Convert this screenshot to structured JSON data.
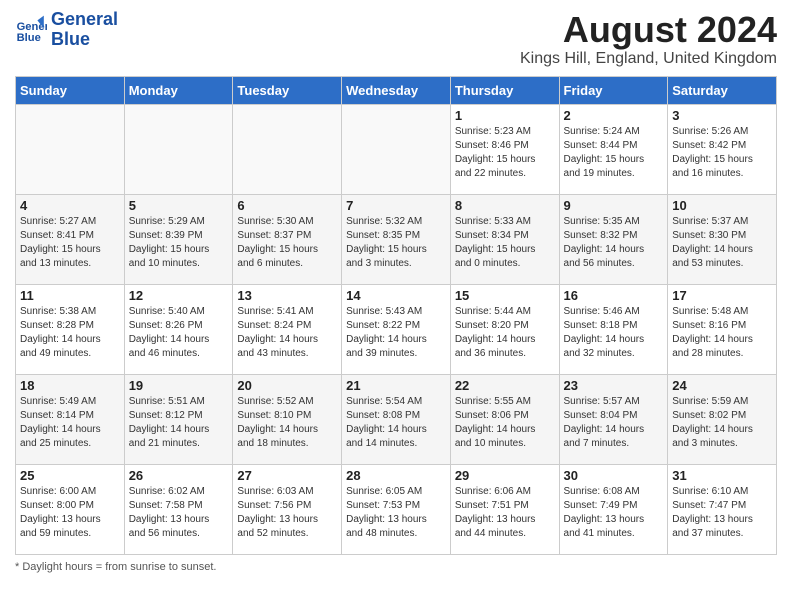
{
  "header": {
    "logo_line1": "General",
    "logo_line2": "Blue",
    "month_title": "August 2024",
    "location": "Kings Hill, England, United Kingdom"
  },
  "days_of_week": [
    "Sunday",
    "Monday",
    "Tuesday",
    "Wednesday",
    "Thursday",
    "Friday",
    "Saturday"
  ],
  "footer": {
    "note": "Daylight hours"
  },
  "weeks": [
    [
      {
        "num": "",
        "sunrise": "",
        "sunset": "",
        "daylight": ""
      },
      {
        "num": "",
        "sunrise": "",
        "sunset": "",
        "daylight": ""
      },
      {
        "num": "",
        "sunrise": "",
        "sunset": "",
        "daylight": ""
      },
      {
        "num": "",
        "sunrise": "",
        "sunset": "",
        "daylight": ""
      },
      {
        "num": "1",
        "sunrise": "5:23 AM",
        "sunset": "8:46 PM",
        "daylight": "15 hours and 22 minutes."
      },
      {
        "num": "2",
        "sunrise": "5:24 AM",
        "sunset": "8:44 PM",
        "daylight": "15 hours and 19 minutes."
      },
      {
        "num": "3",
        "sunrise": "5:26 AM",
        "sunset": "8:42 PM",
        "daylight": "15 hours and 16 minutes."
      }
    ],
    [
      {
        "num": "4",
        "sunrise": "5:27 AM",
        "sunset": "8:41 PM",
        "daylight": "15 hours and 13 minutes."
      },
      {
        "num": "5",
        "sunrise": "5:29 AM",
        "sunset": "8:39 PM",
        "daylight": "15 hours and 10 minutes."
      },
      {
        "num": "6",
        "sunrise": "5:30 AM",
        "sunset": "8:37 PM",
        "daylight": "15 hours and 6 minutes."
      },
      {
        "num": "7",
        "sunrise": "5:32 AM",
        "sunset": "8:35 PM",
        "daylight": "15 hours and 3 minutes."
      },
      {
        "num": "8",
        "sunrise": "5:33 AM",
        "sunset": "8:34 PM",
        "daylight": "15 hours and 0 minutes."
      },
      {
        "num": "9",
        "sunrise": "5:35 AM",
        "sunset": "8:32 PM",
        "daylight": "14 hours and 56 minutes."
      },
      {
        "num": "10",
        "sunrise": "5:37 AM",
        "sunset": "8:30 PM",
        "daylight": "14 hours and 53 minutes."
      }
    ],
    [
      {
        "num": "11",
        "sunrise": "5:38 AM",
        "sunset": "8:28 PM",
        "daylight": "14 hours and 49 minutes."
      },
      {
        "num": "12",
        "sunrise": "5:40 AM",
        "sunset": "8:26 PM",
        "daylight": "14 hours and 46 minutes."
      },
      {
        "num": "13",
        "sunrise": "5:41 AM",
        "sunset": "8:24 PM",
        "daylight": "14 hours and 43 minutes."
      },
      {
        "num": "14",
        "sunrise": "5:43 AM",
        "sunset": "8:22 PM",
        "daylight": "14 hours and 39 minutes."
      },
      {
        "num": "15",
        "sunrise": "5:44 AM",
        "sunset": "8:20 PM",
        "daylight": "14 hours and 36 minutes."
      },
      {
        "num": "16",
        "sunrise": "5:46 AM",
        "sunset": "8:18 PM",
        "daylight": "14 hours and 32 minutes."
      },
      {
        "num": "17",
        "sunrise": "5:48 AM",
        "sunset": "8:16 PM",
        "daylight": "14 hours and 28 minutes."
      }
    ],
    [
      {
        "num": "18",
        "sunrise": "5:49 AM",
        "sunset": "8:14 PM",
        "daylight": "14 hours and 25 minutes."
      },
      {
        "num": "19",
        "sunrise": "5:51 AM",
        "sunset": "8:12 PM",
        "daylight": "14 hours and 21 minutes."
      },
      {
        "num": "20",
        "sunrise": "5:52 AM",
        "sunset": "8:10 PM",
        "daylight": "14 hours and 18 minutes."
      },
      {
        "num": "21",
        "sunrise": "5:54 AM",
        "sunset": "8:08 PM",
        "daylight": "14 hours and 14 minutes."
      },
      {
        "num": "22",
        "sunrise": "5:55 AM",
        "sunset": "8:06 PM",
        "daylight": "14 hours and 10 minutes."
      },
      {
        "num": "23",
        "sunrise": "5:57 AM",
        "sunset": "8:04 PM",
        "daylight": "14 hours and 7 minutes."
      },
      {
        "num": "24",
        "sunrise": "5:59 AM",
        "sunset": "8:02 PM",
        "daylight": "14 hours and 3 minutes."
      }
    ],
    [
      {
        "num": "25",
        "sunrise": "6:00 AM",
        "sunset": "8:00 PM",
        "daylight": "13 hours and 59 minutes."
      },
      {
        "num": "26",
        "sunrise": "6:02 AM",
        "sunset": "7:58 PM",
        "daylight": "13 hours and 56 minutes."
      },
      {
        "num": "27",
        "sunrise": "6:03 AM",
        "sunset": "7:56 PM",
        "daylight": "13 hours and 52 minutes."
      },
      {
        "num": "28",
        "sunrise": "6:05 AM",
        "sunset": "7:53 PM",
        "daylight": "13 hours and 48 minutes."
      },
      {
        "num": "29",
        "sunrise": "6:06 AM",
        "sunset": "7:51 PM",
        "daylight": "13 hours and 44 minutes."
      },
      {
        "num": "30",
        "sunrise": "6:08 AM",
        "sunset": "7:49 PM",
        "daylight": "13 hours and 41 minutes."
      },
      {
        "num": "31",
        "sunrise": "6:10 AM",
        "sunset": "7:47 PM",
        "daylight": "13 hours and 37 minutes."
      }
    ]
  ]
}
